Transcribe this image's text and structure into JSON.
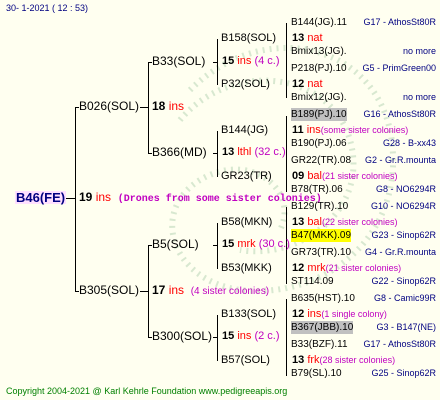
{
  "header": "30-   1-2021  (  12 : 53)",
  "footer": "Copyright 2004-2021 @ Karl Kehrle Foundation    www.pedigreeapis.org",
  "root": {
    "name": "B46(FE)",
    "num": "19",
    "suffix": "ins",
    "note": "(Drones from some sister colonies)"
  },
  "mother": {
    "name": "B026(SOL)",
    "num": "18",
    "suffix": "ins"
  },
  "father": {
    "name": "B305(SOL)",
    "num": "17",
    "suffix": "ins",
    "note": "(4 sister colonies)"
  },
  "g3": [
    {
      "name": "B33(SOL)",
      "num": "15",
      "suffix": "ins",
      "note": "(4 c.)"
    },
    {
      "name": "B366(MD)",
      "num": "13",
      "suffix": "lthl",
      "note": "(32 c.)"
    },
    {
      "name": "B5(SOL)",
      "num": "15",
      "suffix": "mrk",
      "note": "(30 c.)"
    },
    {
      "name": "B300(SOL)",
      "num": "15",
      "suffix": "ins",
      "note": "(2 c.)"
    }
  ],
  "g4": [
    {
      "name": "B158(SOL)",
      "num": "13",
      "suffix": "nat"
    },
    {
      "name": "P32(SOL)",
      "num": "12",
      "suffix": "nat"
    },
    {
      "name": "B144(JG)",
      "num": "11",
      "suffix": "ins",
      "note": "(some sister colonies)"
    },
    {
      "name": "GR23(TR)",
      "num": "09",
      "suffix": "bal",
      "note": "(21 sister colonies)"
    },
    {
      "name": "B58(MKN)",
      "num": "13",
      "suffix": "bal",
      "note": "(22 sister colonies)"
    },
    {
      "name": "B53(MKK)",
      "num": "12",
      "suffix": "mrk",
      "note": "(21 sister colonies)"
    },
    {
      "name": "B133(SOL)",
      "num": "12",
      "suffix": "ins",
      "note": "(1 single colony)"
    },
    {
      "name": "B57(SOL)",
      "num": "13",
      "suffix": "frk",
      "note": "(28 sister colonies)"
    }
  ],
  "g5": [
    {
      "name": "B144(JG).11",
      "breeder": "G17 - AthosSt80R"
    },
    {
      "name": "Bmix13(JG).",
      "breeder": "no more"
    },
    {
      "name": "P218(PJ).10",
      "breeder": "G5 - PrimGreen00"
    },
    {
      "name": "Bmix12(JG).",
      "breeder": "no more"
    },
    {
      "name": "B189(PJ).10",
      "breeder": "G16 - AthosSt80R"
    },
    {
      "name": "B190(PJ).06",
      "breeder": "G28 - B-xx43"
    },
    {
      "name": "GR22(TR).08",
      "breeder": "G2 - Gr.R.mounta"
    },
    {
      "name": "B78(TR).06",
      "breeder": "G8 - NO6294R"
    },
    {
      "name": "B129(TR).10",
      "breeder": "G10 - NO6294R"
    },
    {
      "name": "B47(MKK).09",
      "breeder": "G23 - Sinop62R"
    },
    {
      "name": "GR73(TR).10",
      "breeder": "G4 - Gr.R.mounta"
    },
    {
      "name": "ST114.09",
      "breeder": "G22 - Sinop62R"
    },
    {
      "name": "B635(HST).10",
      "breeder": "G8 - Camic99R"
    },
    {
      "name": "B367(JBB).10",
      "breeder": "G3 - B147(NE)"
    },
    {
      "name": "B33(BZF).11",
      "breeder": "G17 - AthosSt80R"
    },
    {
      "name": "B79(SL).10",
      "breeder": "G25 - Sinop62R"
    }
  ]
}
